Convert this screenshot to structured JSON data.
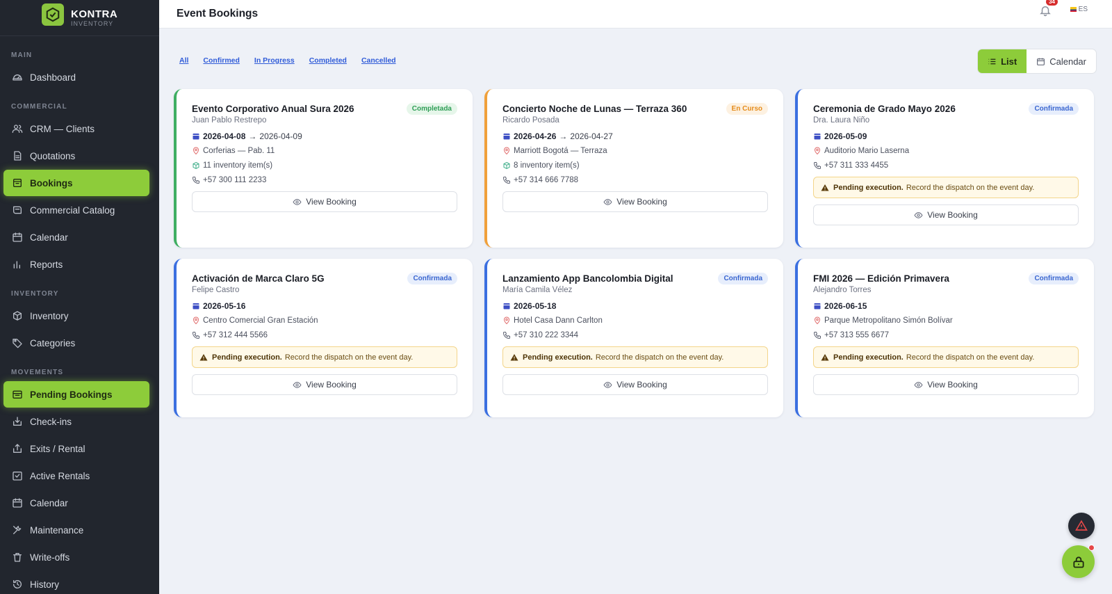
{
  "brand": {
    "name": "KONTRA",
    "sub": "INVENTORY"
  },
  "sidebar": {
    "sections": [
      {
        "label": "MAIN",
        "items": [
          {
            "label": "Dashboard",
            "icon": "dashboard-icon"
          }
        ]
      },
      {
        "label": "COMMERCIAL",
        "items": [
          {
            "label": "CRM — Clients",
            "icon": "users-icon"
          },
          {
            "label": "Quotations",
            "icon": "document-icon"
          },
          {
            "label": "Bookings",
            "icon": "bookings-icon",
            "active": true
          },
          {
            "label": "Commercial Catalog",
            "icon": "catalog-icon"
          },
          {
            "label": "Calendar",
            "icon": "calendar-icon"
          },
          {
            "label": "Reports",
            "icon": "chart-icon"
          }
        ]
      },
      {
        "label": "INVENTORY",
        "items": [
          {
            "label": "Inventory",
            "icon": "box-icon"
          },
          {
            "label": "Categories",
            "icon": "tag-icon"
          }
        ]
      },
      {
        "label": "MOVEMENTS",
        "items": [
          {
            "label": "Pending Bookings",
            "icon": "pending-icon",
            "active": true
          },
          {
            "label": "Check-ins",
            "icon": "checkin-icon"
          },
          {
            "label": "Exits / Rental",
            "icon": "exit-icon"
          },
          {
            "label": "Active Rentals",
            "icon": "active-rentals-icon"
          },
          {
            "label": "Calendar",
            "icon": "calendar-icon"
          },
          {
            "label": "Maintenance",
            "icon": "wrench-icon"
          },
          {
            "label": "Write-offs",
            "icon": "trash-icon"
          },
          {
            "label": "History",
            "icon": "history-icon"
          }
        ]
      }
    ]
  },
  "header": {
    "title": "Event Bookings",
    "notifications": "34",
    "language": "ES"
  },
  "filters": [
    "All",
    "Confirmed",
    "In Progress",
    "Completed",
    "Cancelled"
  ],
  "view_toggle": {
    "list": "List",
    "calendar": "Calendar",
    "selected": "List"
  },
  "warning": {
    "bold": "Pending execution.",
    "text": "Record the dispatch on the event day."
  },
  "view_booking_label": "View Booking",
  "bookings": [
    {
      "title": "Evento Corporativo Anual Sura 2026",
      "client": "Juan Pablo Restrepo",
      "status": "Completada",
      "status_type": "done",
      "date_start": "2026-04-08",
      "date_end": "2026-04-09",
      "venue": "Corferias — Pab. 11",
      "items": "11 inventory item(s)",
      "phone": "+57 300 111 2233",
      "pending": false
    },
    {
      "title": "Concierto Noche de Lunas — Terraza 360",
      "client": "Ricardo Posada",
      "status": "En Curso",
      "status_type": "prog",
      "date_start": "2026-04-26",
      "date_end": "2026-04-27",
      "venue": "Marriott Bogotá — Terraza",
      "items": "8 inventory item(s)",
      "phone": "+57 314 666 7788",
      "pending": false
    },
    {
      "title": "Ceremonia de Grado Mayo 2026",
      "client": "Dra. Laura Niño",
      "status": "Confirmada",
      "status_type": "conf",
      "date_start": "2026-05-09",
      "date_end": "",
      "venue": "Auditorio Mario Laserna",
      "items": "",
      "phone": "+57 311 333 4455",
      "pending": true
    },
    {
      "title": "Activación de Marca Claro 5G",
      "client": "Felipe Castro",
      "status": "Confirmada",
      "status_type": "conf",
      "date_start": "2026-05-16",
      "date_end": "",
      "venue": "Centro Comercial Gran Estación",
      "items": "",
      "phone": "+57 312 444 5566",
      "pending": true
    },
    {
      "title": "Lanzamiento App Bancolombia Digital",
      "client": "María Camila Vélez",
      "status": "Confirmada",
      "status_type": "conf",
      "date_start": "2026-05-18",
      "date_end": "",
      "venue": "Hotel Casa Dann Carlton",
      "items": "",
      "phone": "+57 310 222 3344",
      "pending": true
    },
    {
      "title": "FMI 2026 — Edición Primavera",
      "client": "Alejandro Torres",
      "status": "Confirmada",
      "status_type": "conf",
      "date_start": "2026-06-15",
      "date_end": "",
      "venue": "Parque Metropolitano Simón Bolívar",
      "items": "",
      "phone": "+57 313 555 6677",
      "pending": true
    }
  ]
}
